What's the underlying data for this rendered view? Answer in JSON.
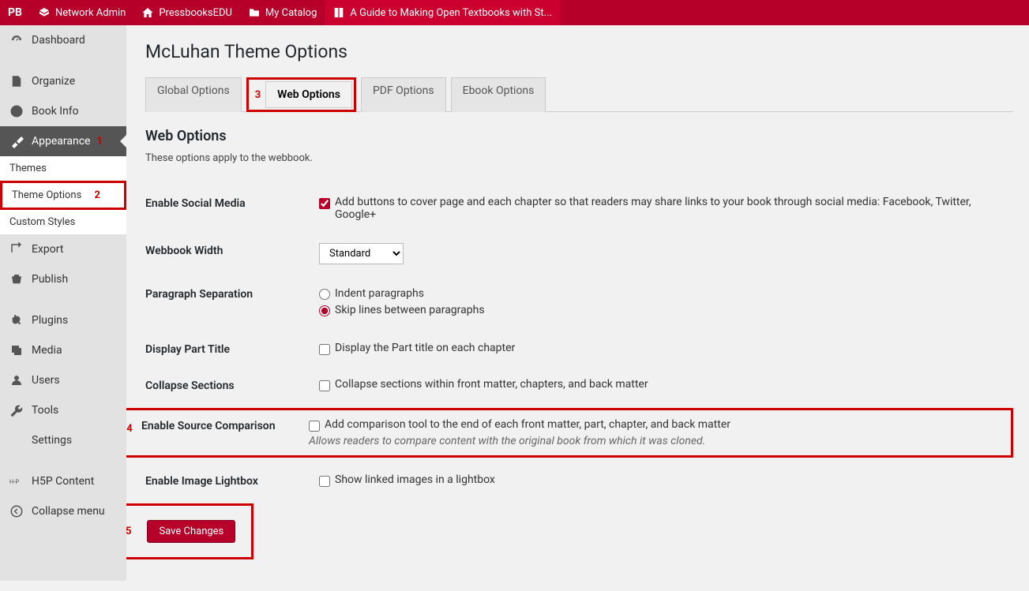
{
  "topbar": {
    "pb": "PB",
    "network_admin": "Network Admin",
    "pressbooks_edu": "PressbooksEDU",
    "my_catalog": "My Catalog",
    "book": "A Guide to Making Open Textbooks with St..."
  },
  "sidebar": {
    "dashboard": "Dashboard",
    "organize": "Organize",
    "book_info": "Book Info",
    "appearance": "Appearance",
    "themes": "Themes",
    "theme_options": "Theme Options",
    "custom_styles": "Custom Styles",
    "export": "Export",
    "publish": "Publish",
    "plugins": "Plugins",
    "media": "Media",
    "users": "Users",
    "tools": "Tools",
    "settings": "Settings",
    "h5p": "H5P Content",
    "collapse": "Collapse menu"
  },
  "annotations": {
    "a1": "1",
    "a2": "2",
    "a3": "3",
    "a4": "4",
    "a5": "5"
  },
  "page": {
    "title": "McLuhan Theme Options",
    "section_title": "Web Options",
    "section_desc": "These options apply to the webbook."
  },
  "tabs": {
    "global": "Global Options",
    "web": "Web Options",
    "pdf": "PDF Options",
    "ebook": "Ebook Options"
  },
  "form": {
    "social": {
      "label": "Enable Social Media",
      "text": "Add buttons to cover page and each chapter so that readers may share links to your book through social media: Facebook, Twitter, Google+"
    },
    "width": {
      "label": "Webbook Width",
      "value": "Standard"
    },
    "para": {
      "label": "Paragraph Separation",
      "indent": "Indent paragraphs",
      "skip": "Skip lines between paragraphs"
    },
    "part": {
      "label": "Display Part Title",
      "text": "Display the Part title on each chapter"
    },
    "collapse": {
      "label": "Collapse Sections",
      "text": "Collapse sections within front matter, chapters, and back matter"
    },
    "source": {
      "label": "Enable Source Comparison",
      "text": "Add comparison tool to the end of each front matter, part, chapter, and back matter",
      "help": "Allows readers to compare content with the original book from which it was cloned."
    },
    "lightbox": {
      "label": "Enable Image Lightbox",
      "text": "Show linked images in a lightbox"
    },
    "save": "Save Changes"
  }
}
